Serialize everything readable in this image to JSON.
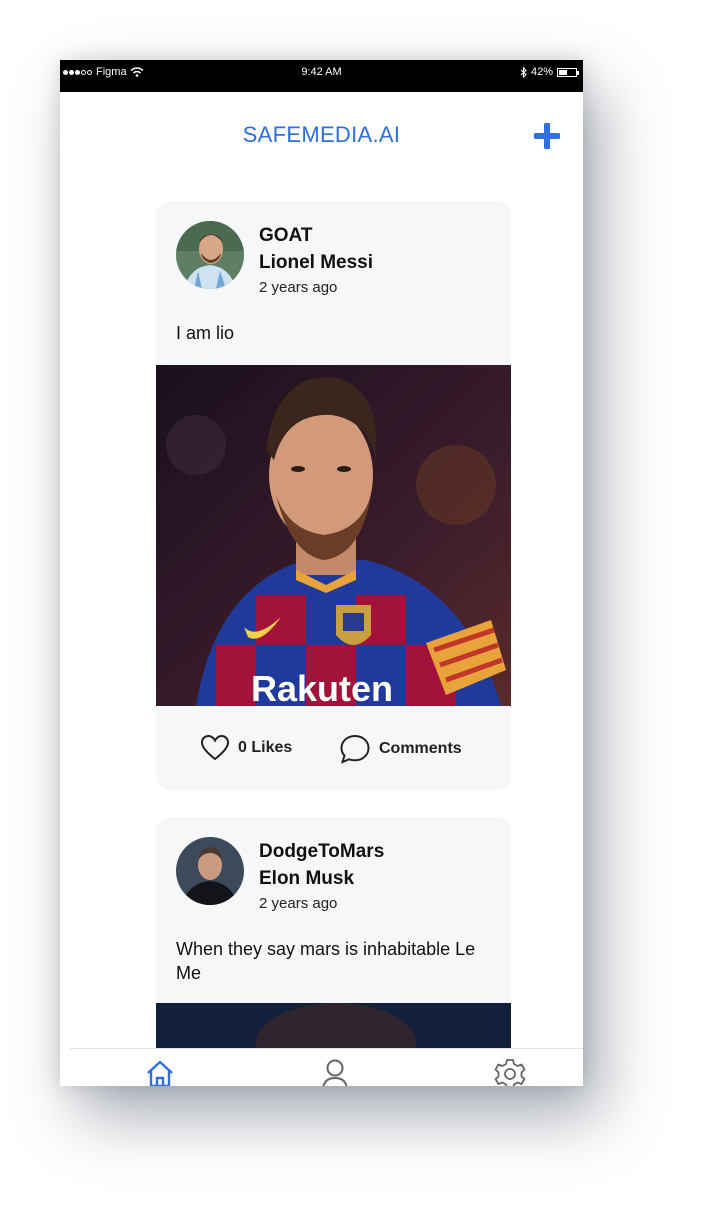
{
  "status_bar": {
    "carrier": "Figma",
    "time": "9:42 AM",
    "battery": "42%"
  },
  "app": {
    "title": "SAFEMEDIA.AI"
  },
  "posts": [
    {
      "handle": "GOAT",
      "name": "Lionel Messi",
      "time_ago": "2 years ago",
      "text": "I am lio",
      "likes_label": "0 Likes",
      "comments_label": "Comments",
      "image_text": "Rakuten"
    },
    {
      "handle": "DodgeToMars",
      "name": "Elon Musk",
      "time_ago": "2 years ago",
      "text": "When they say mars is inhabitable Le Me"
    }
  ],
  "tabs": [
    {
      "icon": "home-icon",
      "active": true
    },
    {
      "icon": "profile-icon",
      "active": false
    },
    {
      "icon": "settings-icon",
      "active": false
    }
  ],
  "colors": {
    "accent": "#2f6fe0",
    "card_bg": "#f6f7f8"
  }
}
